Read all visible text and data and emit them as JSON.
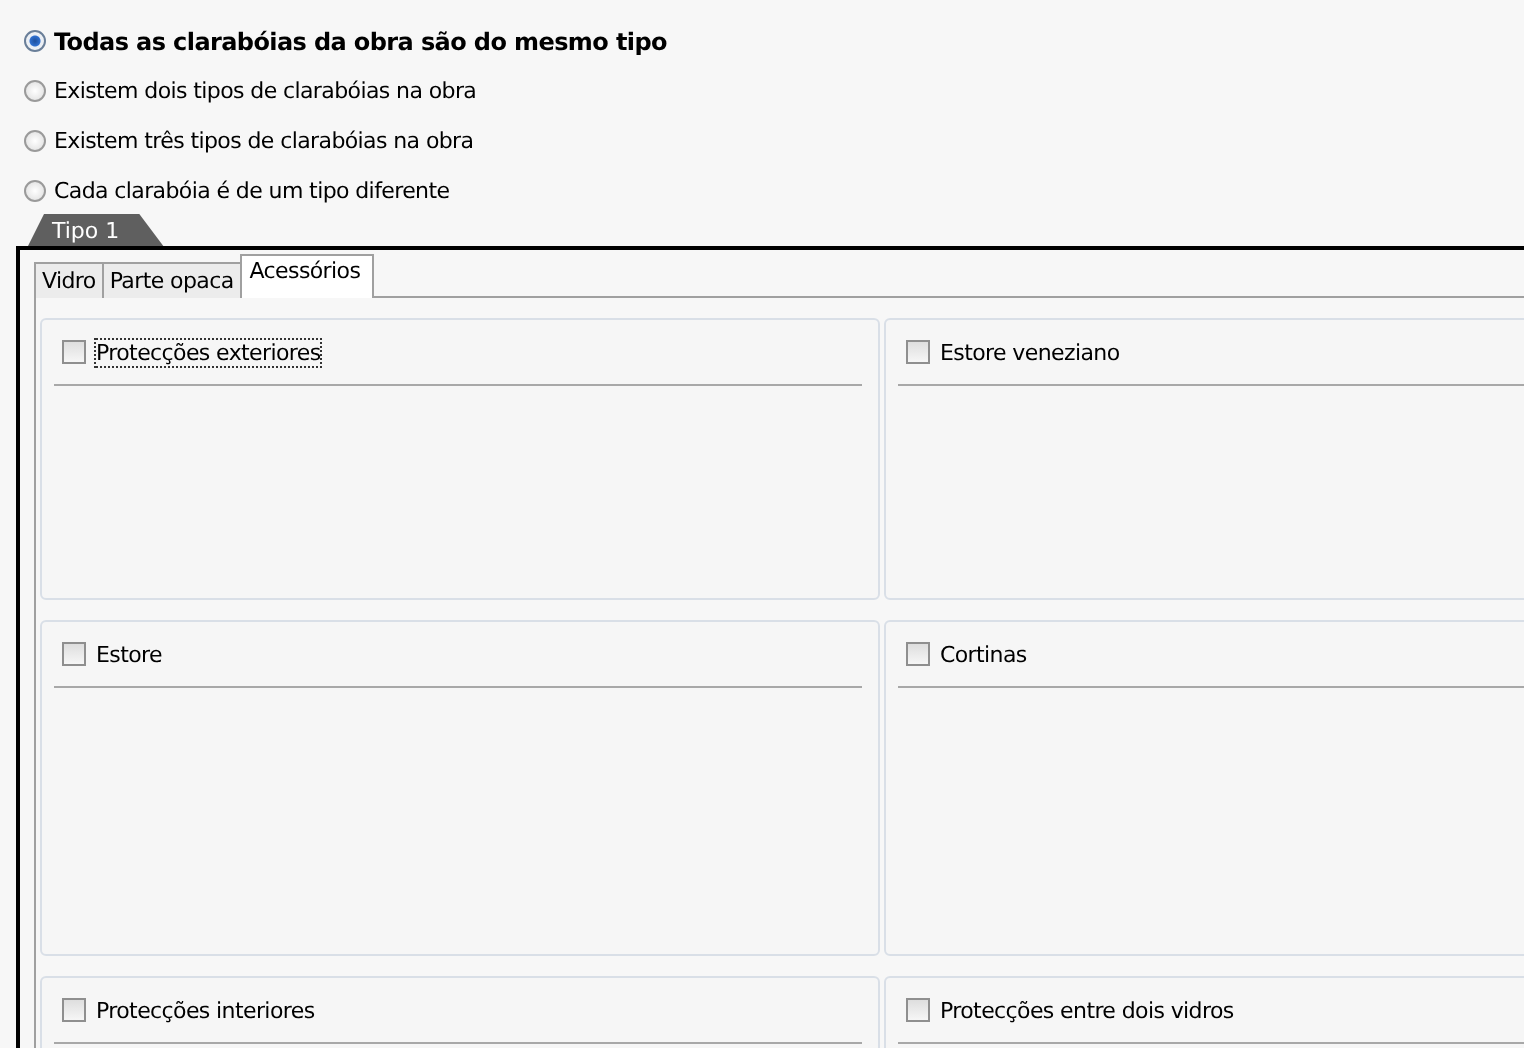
{
  "options": [
    {
      "label": "Todas as clarabóias da obra são do mesmo tipo",
      "selected": true
    },
    {
      "label": "Existem dois tipos de clarabóias na obra",
      "selected": false
    },
    {
      "label": "Existem três tipos de clarabóias na obra",
      "selected": false
    },
    {
      "label": "Cada clarabóia é de um tipo diferente",
      "selected": false
    }
  ],
  "type_tabs": [
    {
      "label": "Tipo 1",
      "selected": true
    }
  ],
  "tabs": [
    {
      "label": "Vidro",
      "selected": false
    },
    {
      "label": "Parte opaca",
      "selected": false
    },
    {
      "label": "Acessórios",
      "selected": true
    }
  ],
  "accessories": [
    {
      "label": "Protecções exteriores",
      "checked": false,
      "focused": true
    },
    {
      "label": "Estore veneziano",
      "checked": false,
      "focused": false
    },
    {
      "label": "Estore",
      "checked": false,
      "focused": false
    },
    {
      "label": "Cortinas",
      "checked": false,
      "focused": false
    },
    {
      "label": "Protecções interiores",
      "checked": false,
      "focused": false
    },
    {
      "label": "Protecções entre dois vidros",
      "checked": false,
      "focused": false
    }
  ]
}
